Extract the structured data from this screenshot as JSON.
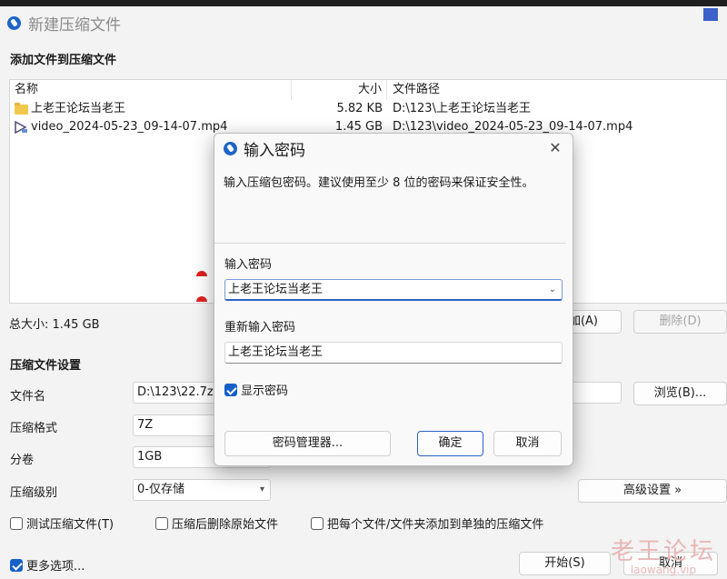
{
  "window": {
    "title": "新建压缩文件"
  },
  "add_section": {
    "label": "添加文件到压缩文件"
  },
  "file_list": {
    "columns": {
      "name": "名称",
      "size": "大小",
      "path": "文件路径"
    },
    "rows": [
      {
        "name": "上老王论坛当老王",
        "size": "5.82 KB",
        "path": "D:\\123\\上老王论坛当老王",
        "icon": "folder-icon"
      },
      {
        "name": "video_2024-05-23_09-14-07.mp4",
        "size": "1.45 GB",
        "path": "D:\\123\\video_2024-05-23_09-14-07.mp4",
        "icon": "video-icon"
      }
    ]
  },
  "total_size": "总大小: 1.45 GB",
  "buttons": {
    "add": "加(A)",
    "delete": "删除(D)",
    "browse": "浏览(B)...",
    "advanced": "高级设置 »",
    "start": "开始(S)",
    "cancel": "取消"
  },
  "settings": {
    "label": "压缩文件设置",
    "filename_label": "文件名",
    "filename_value": "D:\\123\\22.7z",
    "format_label": "压缩格式",
    "format_value": "7Z",
    "split_label": "分卷",
    "split_value": "1GB",
    "level_label": "压缩级别",
    "level_value": "0-仅存储"
  },
  "options": {
    "test": "测试压缩文件(T)",
    "delete_after": "压缩后删除原始文件",
    "separate": "把每个文件/文件夹添加到单独的压缩文件",
    "more": "更多选项..."
  },
  "dialog": {
    "title": "输入密码",
    "description": "输入压缩包密码。建议使用至少 8 位的密码来保证安全性。",
    "password_label": "输入密码",
    "password_value": "上老王论坛当老王",
    "reenter_label": "重新输入密码",
    "reenter_value": "上老王论坛当老王",
    "show_password": "显示密码",
    "show_password_checked": true,
    "manager_button": "密码管理器...",
    "ok_button": "确定",
    "cancel_button": "取消"
  },
  "watermark": {
    "main": "老王论坛",
    "sub": "laowang.vip"
  },
  "colors": {
    "accent": "#1660c9",
    "watermark": "#e9b6b6"
  }
}
